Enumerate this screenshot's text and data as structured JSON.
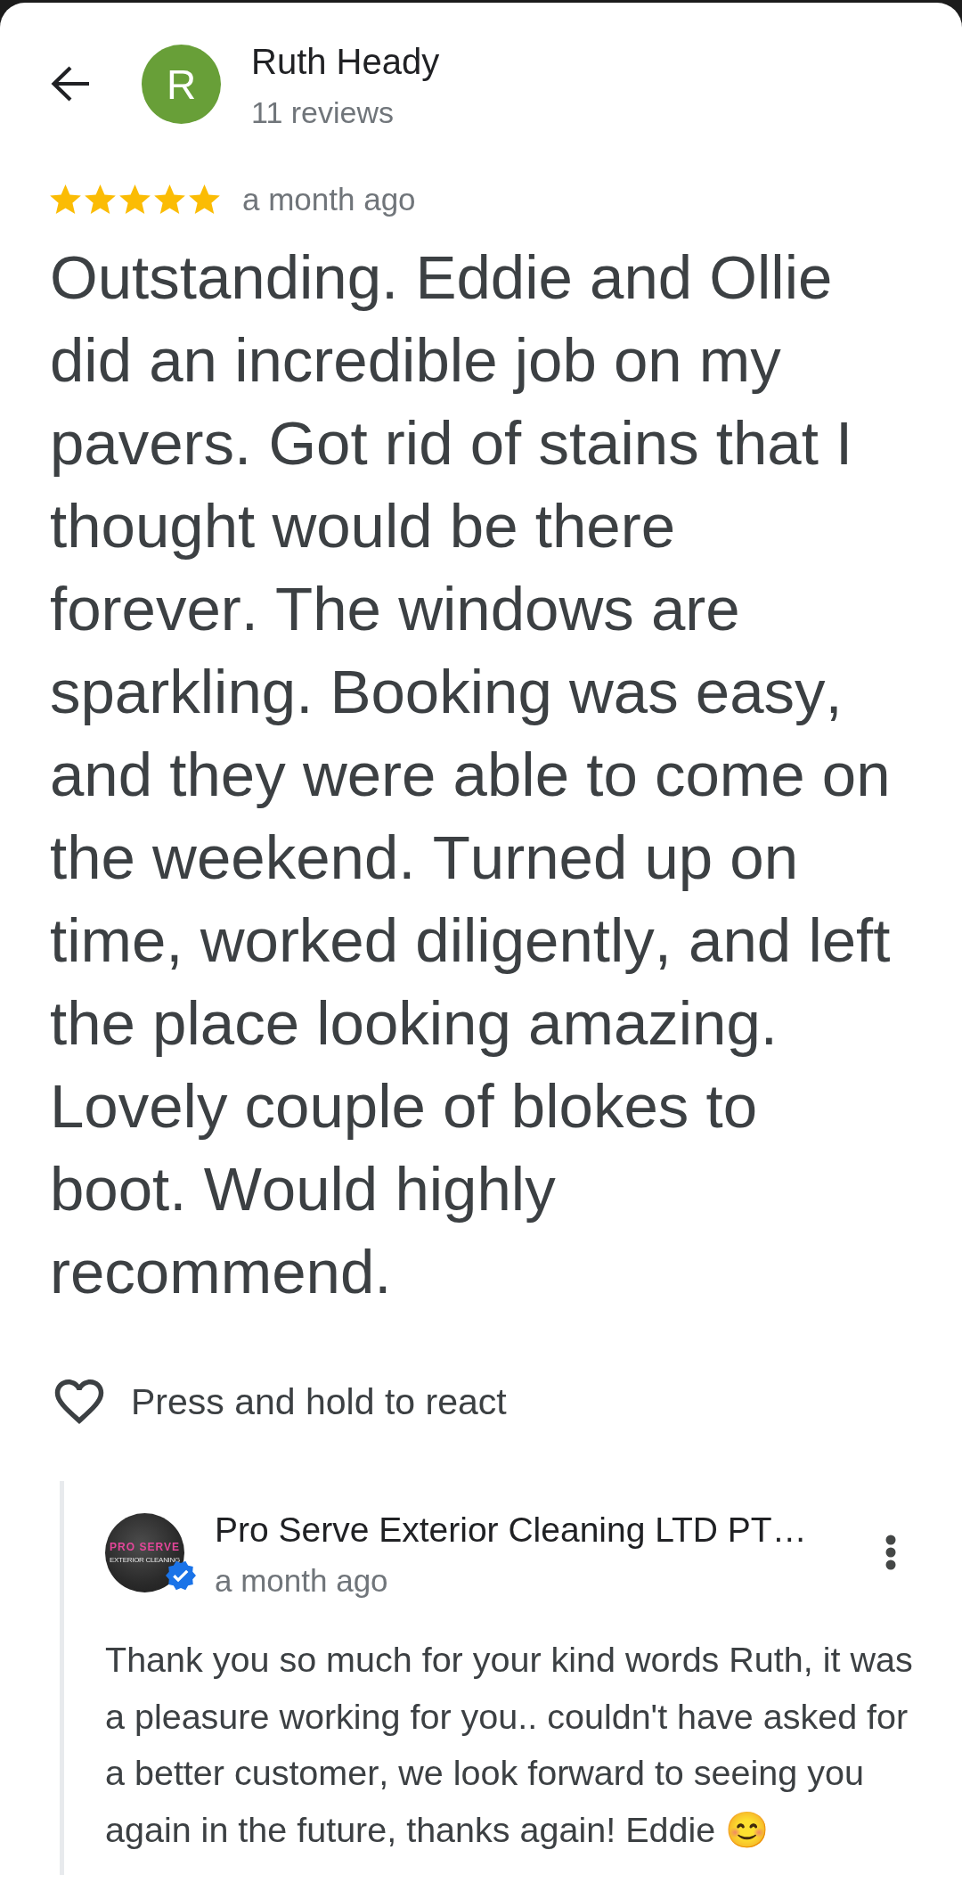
{
  "reviewer": {
    "avatar_letter": "R",
    "name": "Ruth Heady",
    "review_count": "11 reviews"
  },
  "review": {
    "stars": 5,
    "time": "a month ago",
    "text": "Outstanding. Eddie and Ollie did an incredible job on my pavers. Got rid of stains that I thought would be there forever. The windows are sparkling. Booking was easy, and they were able to come on the weekend. Turned up on time, worked diligently, and left the place looking amazing. Lovely couple of blokes to boot. Would highly recommend."
  },
  "reaction": {
    "hint": "Press and hold to react"
  },
  "owner_reply": {
    "logo": {
      "title": "PRO SERVE",
      "subtitle": "EXTERIOR CLEANING"
    },
    "verified": true,
    "name": "Pro Serve Exterior Cleaning LTD PT…",
    "time": "a month ago",
    "text": "Thank you so much for your kind words Ruth, it was a pleasure working for you.. couldn't have asked for a better customer, we look forward to seeing you again in the future, thanks again! Eddie 😊"
  }
}
